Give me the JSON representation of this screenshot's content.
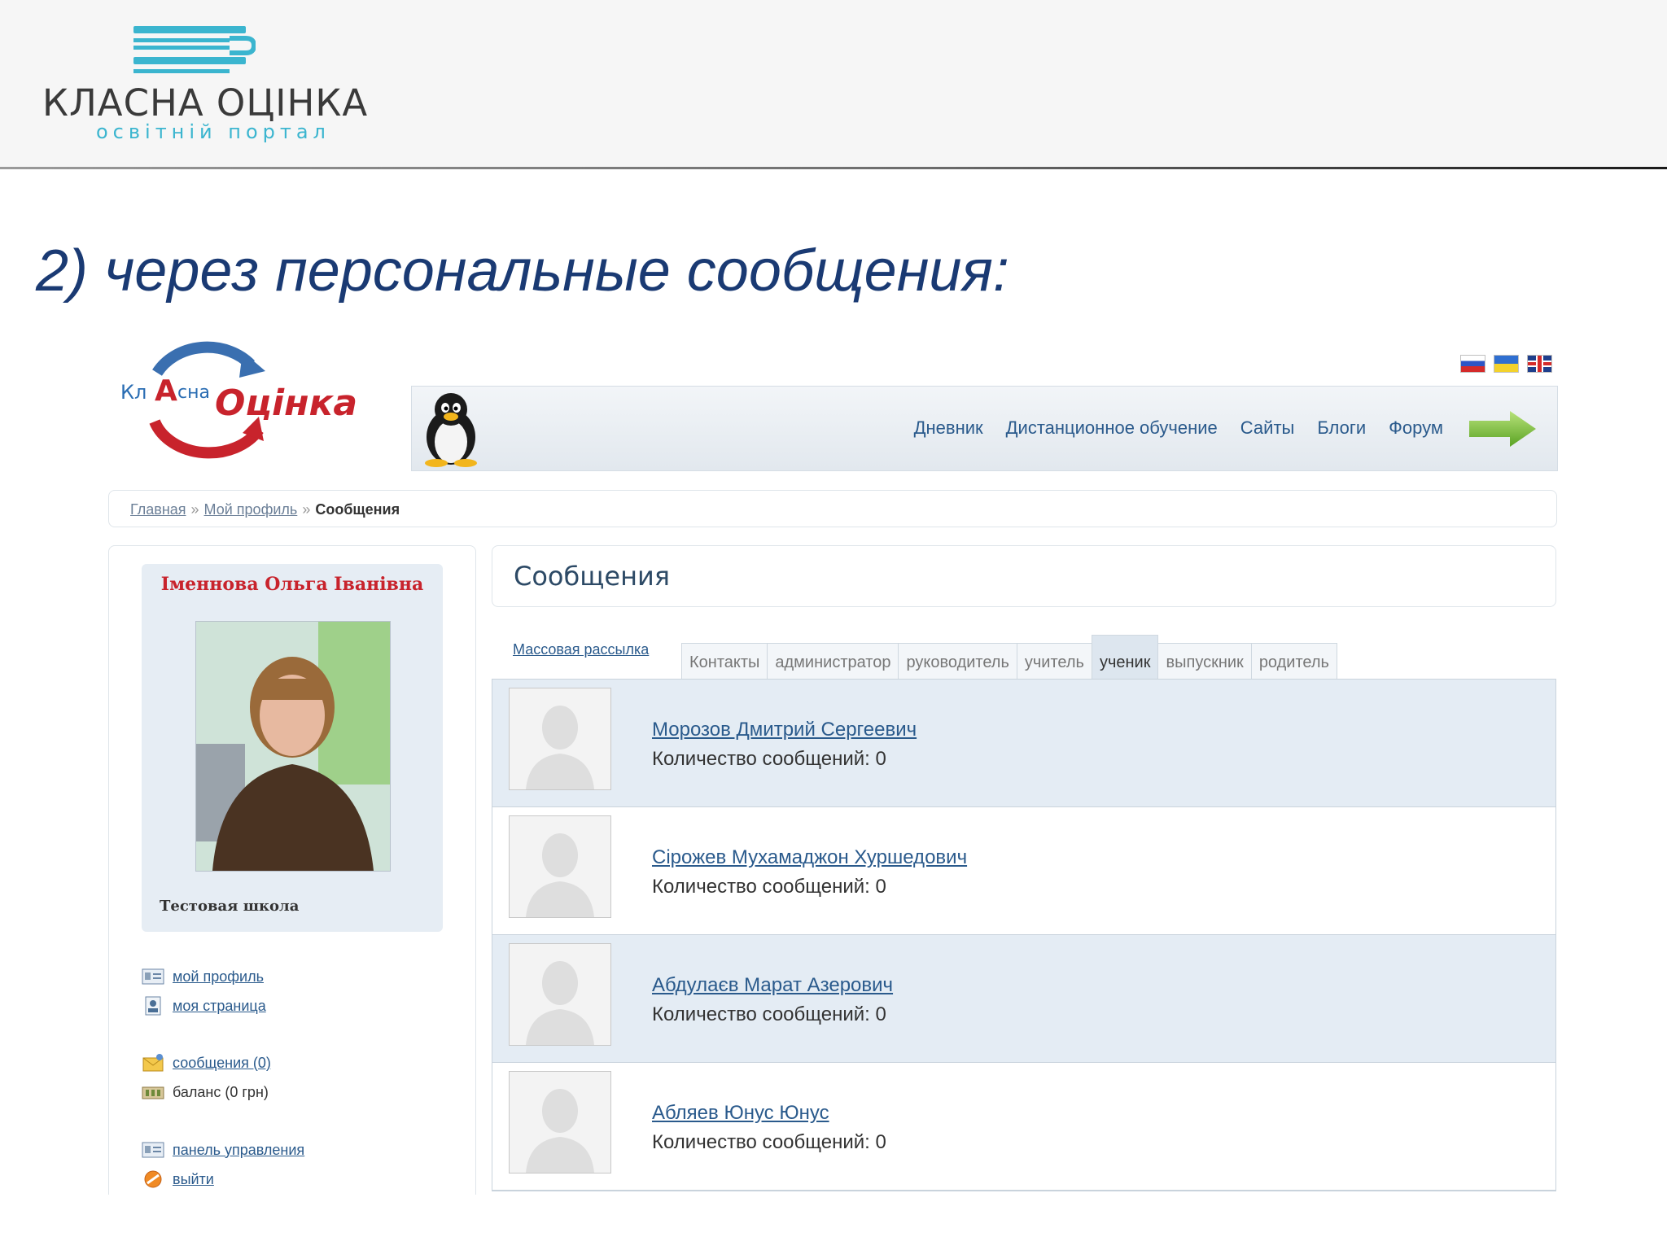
{
  "slide": {
    "brand_name": "КЛАСНА ОЦІНКА",
    "brand_tagline": "освітній портал",
    "title": "2) через персональные сообщения:"
  },
  "site": {
    "logo": {
      "kl": "Кл",
      "a": "А",
      "sna": "сна",
      "ocinka": "Оцінка"
    },
    "languages": [
      "ru-flag",
      "ua-flag",
      "gb-flag"
    ],
    "nav": [
      "Дневник",
      "Дистанционное обучение",
      "Сайты",
      "Блоги",
      "Форум"
    ],
    "breadcrumb": {
      "home": "Главная",
      "profile": "Мой профиль",
      "separator": "»",
      "current": "Сообщения"
    },
    "profile": {
      "name": "Іменнова Ольга Іванівна",
      "school": "Тестовая школа"
    },
    "menu": {
      "my_profile": "мой профиль",
      "my_page": "моя страница",
      "messages": "сообщения (0)",
      "balance": "баланс (0 грн)",
      "control_panel": "панель управления",
      "logout": "выйти"
    },
    "messages": {
      "title": "Сообщения",
      "mass_mailing": "Массовая рассылка",
      "tabs": [
        "Контакты",
        "администратор",
        "руководитель",
        "учитель",
        "ученик",
        "выпускник",
        "родитель"
      ],
      "active_tab": "ученик",
      "contacts": [
        {
          "name": "Морозов Дмитрий Сергеевич",
          "count": "Количество сообщений: 0"
        },
        {
          "name": "Сірожев Мухамаджон Хуршедович",
          "count": "Количество сообщений: 0"
        },
        {
          "name": "Абдулаєв Марат Азерович",
          "count": "Количество сообщений: 0"
        },
        {
          "name": "Абляев Юнус Юнус",
          "count": "Количество сообщений: 0"
        }
      ]
    }
  },
  "colors": {
    "slide_title": "#1a3a73",
    "brand_teal": "#3bb5cf",
    "link_blue": "#2a5a8c",
    "accent_red": "#c8232c",
    "row_shade": "#e4ecf4"
  }
}
